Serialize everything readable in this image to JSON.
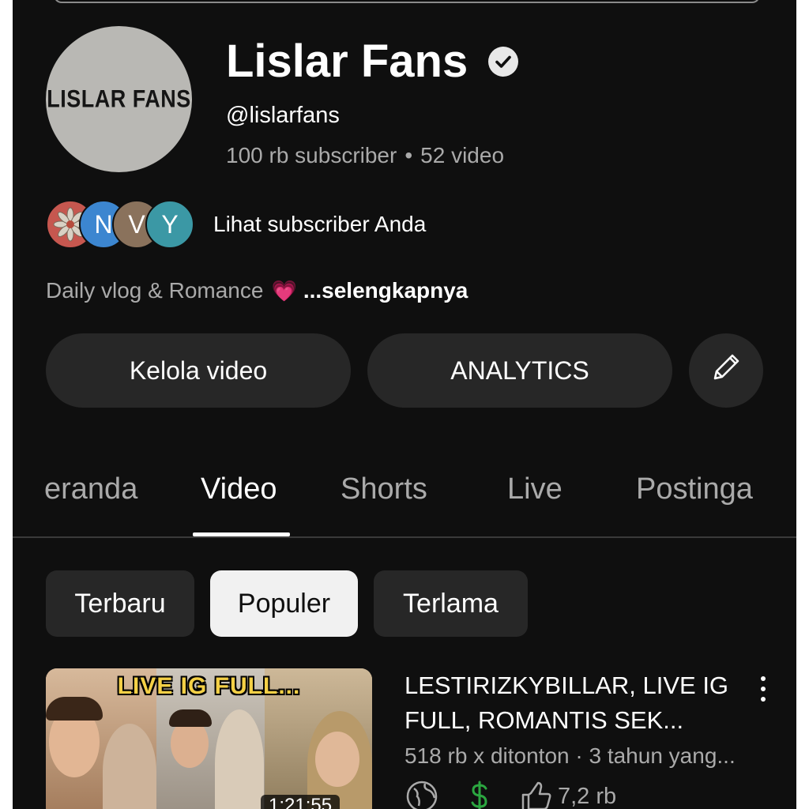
{
  "channel": {
    "avatar_text": "LISLAR FANS",
    "name": "Lislar Fans",
    "handle": "@lislarfans",
    "subscribers": "100 rb subscriber",
    "separator": "•",
    "videos": "52 video",
    "subscriber_avatars": [
      "N",
      "V",
      "Y"
    ],
    "subscribers_link": "Lihat subscriber Anda",
    "description": "Daily vlog & Romance",
    "description_emoji": "💗",
    "description_more": "...selengkapnya"
  },
  "actions": {
    "manage_videos": "Kelola video",
    "analytics": "ANALYTICS"
  },
  "tabs": [
    {
      "label": "eranda"
    },
    {
      "label": "Video"
    },
    {
      "label": "Shorts"
    },
    {
      "label": "Live"
    },
    {
      "label": "Postinga"
    }
  ],
  "active_tab": "Video",
  "filters": [
    {
      "label": "Terbaru"
    },
    {
      "label": "Populer"
    },
    {
      "label": "Terlama"
    }
  ],
  "active_filter": "Populer",
  "video": {
    "thumbnail_text": "LIVE IG FULL...",
    "duration": "1:21:55",
    "title": "LESTIRIZKYBILLAR, LIVE IG FULL, ROMANTIS SEK...",
    "meta": "518 rb x ditonton · 3 tahun yang...",
    "likes": "7,2 rb"
  },
  "colors": {
    "background": "#0f0f0f",
    "surface": "#272727",
    "secondary_text": "#aaaaaa",
    "selected_chip": "#f1f1f1",
    "thumbnail_title": "#f4d046"
  },
  "icons": [
    "verified-check-icon",
    "pencil-icon",
    "globe-icon",
    "dollar-icon",
    "thumbs-up-icon",
    "more-vert-icon"
  ]
}
